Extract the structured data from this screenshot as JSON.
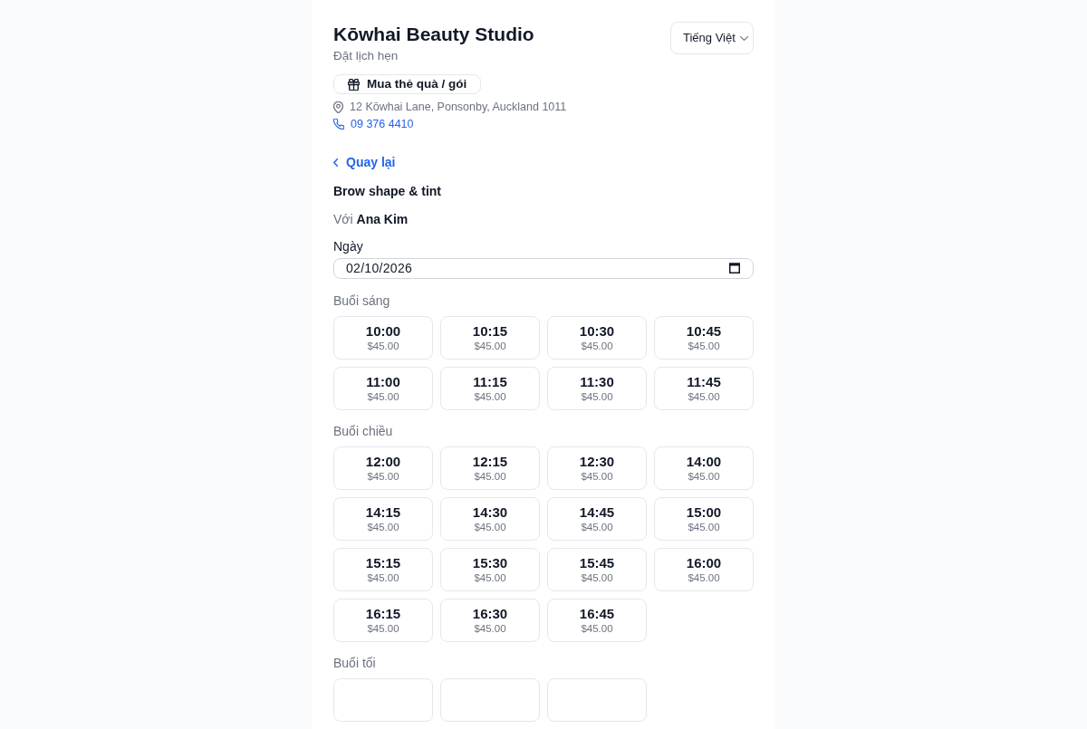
{
  "header": {
    "title": "Kōwhai Beauty Studio",
    "subtitle": "Đặt lịch hẹn",
    "language_select": {
      "value": "Tiếng Việt"
    }
  },
  "gift_button": {
    "label": "Mua thẻ quà / gói"
  },
  "contact": {
    "address": "12 Kōwhai Lane, Ponsonby, Auckland 1011",
    "phone": "09 376 4410"
  },
  "back_link": {
    "label": "Quay lại"
  },
  "service": {
    "name": "Brow shape & tint",
    "staff_line": "Với **Ana Kim**"
  },
  "date_field": {
    "label": "Ngày",
    "value": "02/10/2026"
  },
  "slot_groups": [
    {
      "heading": "Buổi sáng",
      "slots": [
        {
          "time": "10:00",
          "price": "$45.00",
          "selected": false
        },
        {
          "time": "10:15",
          "price": "$45.00",
          "selected": false
        },
        {
          "time": "10:30",
          "price": "$45.00",
          "selected": false
        },
        {
          "time": "10:45",
          "price": "$45.00",
          "selected": false
        },
        {
          "time": "11:00",
          "price": "$45.00",
          "selected": false
        },
        {
          "time": "11:15",
          "price": "$45.00",
          "selected": false
        },
        {
          "time": "11:30",
          "price": "$45.00",
          "selected": false
        },
        {
          "time": "11:45",
          "price": "$45.00",
          "selected": false
        }
      ]
    },
    {
      "heading": "Buổi chiều",
      "slots": [
        {
          "time": "12:00",
          "price": "$45.00",
          "selected": false
        },
        {
          "time": "12:15",
          "price": "$45.00",
          "selected": false
        },
        {
          "time": "12:30",
          "price": "$45.00",
          "selected": false
        },
        {
          "time": "14:00",
          "price": "$45.00",
          "selected": false
        },
        {
          "time": "14:15",
          "price": "$45.00",
          "selected": false
        },
        {
          "time": "14:30",
          "price": "$45.00",
          "selected": false
        },
        {
          "time": "14:45",
          "price": "$45.00",
          "selected": false
        },
        {
          "time": "15:00",
          "price": "$45.00",
          "selected": false
        },
        {
          "time": "15:15",
          "price": "$45.00",
          "selected": false
        },
        {
          "time": "15:30",
          "price": "$45.00",
          "selected": false
        },
        {
          "time": "15:45",
          "price": "$45.00",
          "selected": false
        },
        {
          "time": "16:00",
          "price": "$45.00",
          "selected": false
        },
        {
          "time": "16:15",
          "price": "$45.00",
          "selected": false
        },
        {
          "time": "16:30",
          "price": "$45.00",
          "selected": false
        },
        {
          "time": "16:45",
          "price": "$45.00",
          "selected": false
        }
      ]
    },
    {
      "heading": "Buổi tối",
      "slots": [
        {
          "selected": false
        },
        {
          "selected": false
        },
        {
          "selected": false
        }
      ]
    }
  ]
}
